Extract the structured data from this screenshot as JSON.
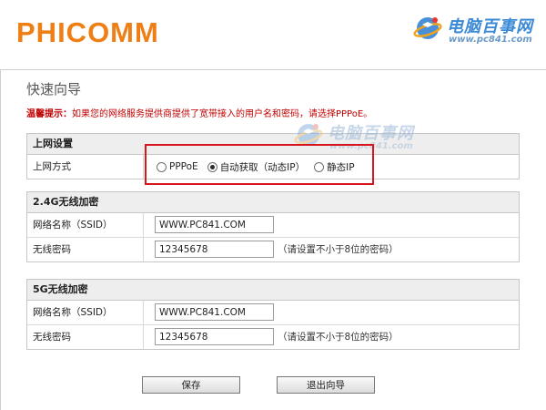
{
  "brand": {
    "logo_text": "PHICOMM",
    "accent": "#ef7e14"
  },
  "watermark": {
    "title": "电脑百事网",
    "url": "www.pc841.com"
  },
  "page": {
    "title": "快速向导",
    "hint_label": "温馨提示：",
    "hint_text": "如果您的网络服务提供商提供了宽带接入的用户名和密码，请选择PPPoE。"
  },
  "internet": {
    "heading": "上网设置",
    "mode_label": "上网方式",
    "options": [
      {
        "label": "PPPoE",
        "checked": false
      },
      {
        "label": "自动获取（动态IP）",
        "checked": true
      },
      {
        "label": "静态IP",
        "checked": false
      }
    ]
  },
  "wifi24": {
    "heading": "2.4G无线加密",
    "ssid_label": "网络名称（SSID）",
    "ssid_value": "WWW.PC841.COM",
    "password_label": "无线密码",
    "password_value": "12345678",
    "password_note": "（请设置不小于8位的密码）"
  },
  "wifi5": {
    "heading": "5G无线加密",
    "ssid_label": "网络名称（SSID）",
    "ssid_value": "WWW.PC841.COM",
    "password_label": "无线密码",
    "password_value": "12345678",
    "password_note": "（请设置不小于8位的密码）"
  },
  "actions": {
    "save_label": "保存",
    "exit_label": "退出向导"
  },
  "colors": {
    "highlight": "#d8141c",
    "hint": "#c00000"
  }
}
